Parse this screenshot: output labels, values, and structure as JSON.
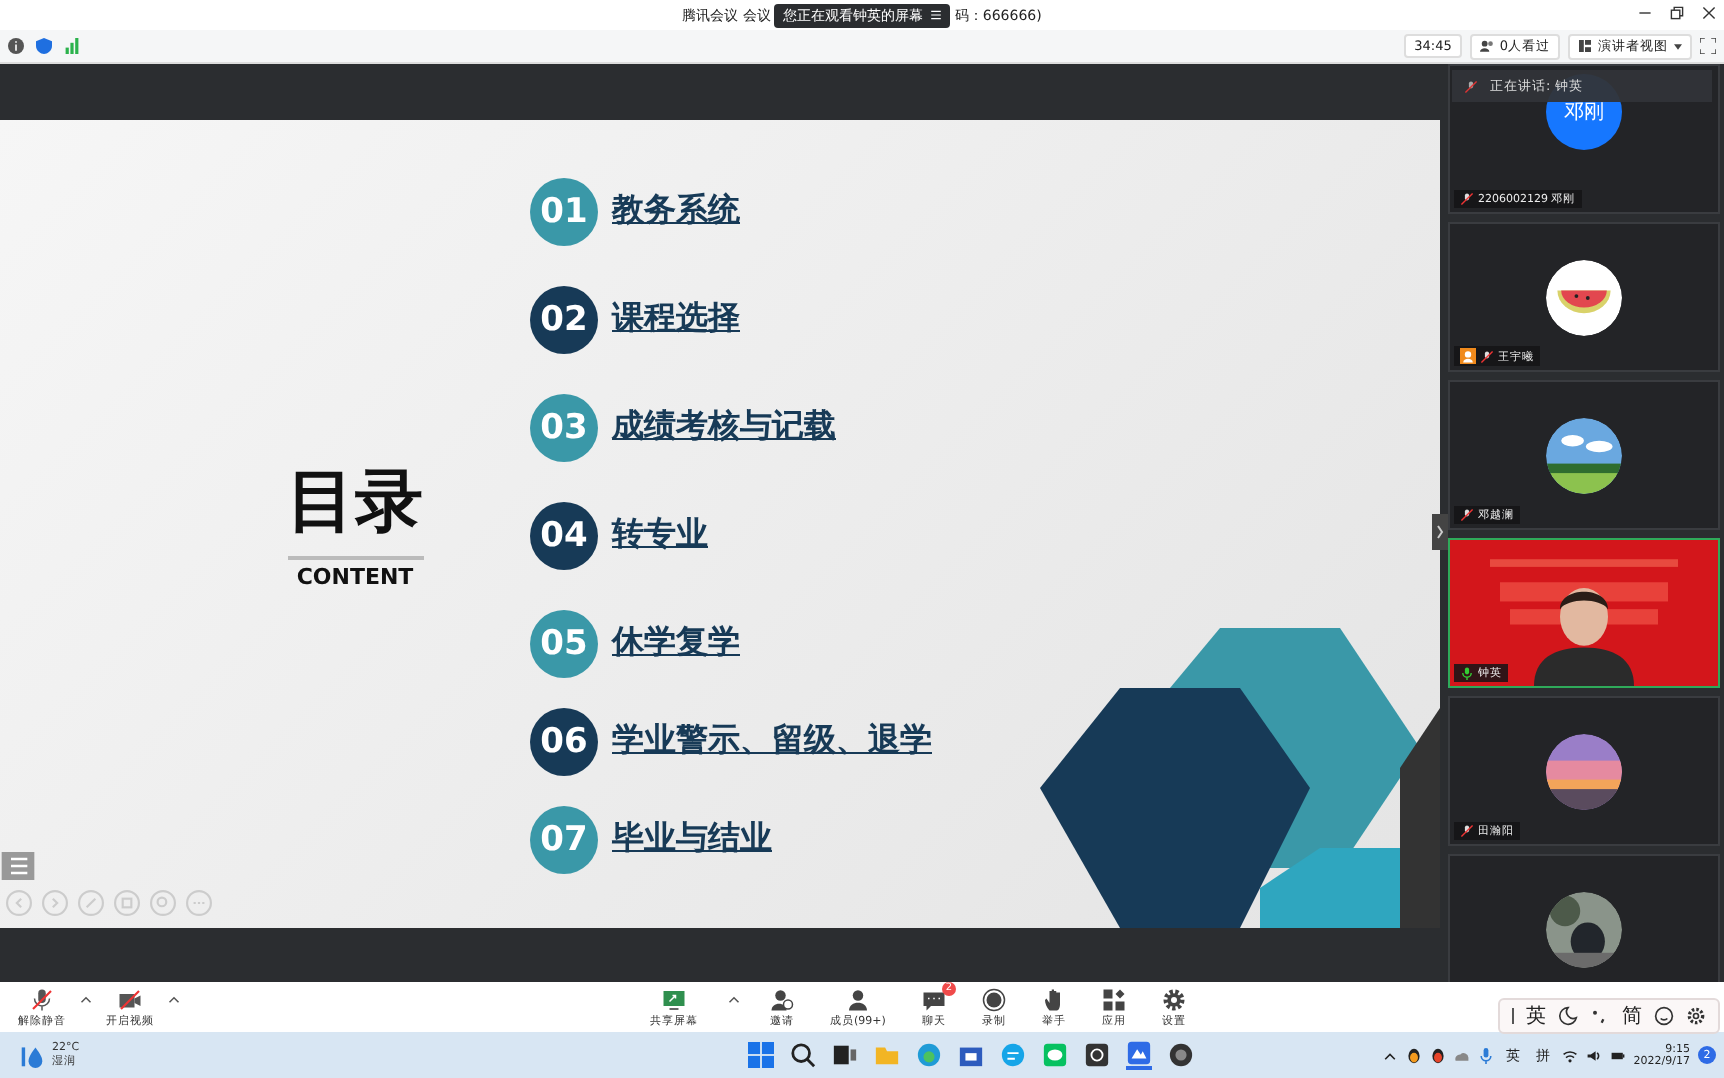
{
  "window": {
    "title_start": "腾讯会议 会议",
    "title_end": "码：666666)",
    "tooltip": "您正在观看钟英的屏幕"
  },
  "toolbar": {
    "timer": "34:45",
    "viewers": "0人看过",
    "view_mode": "演讲者视图"
  },
  "slide": {
    "title": "目录",
    "subtitle": "CONTENT",
    "items": [
      {
        "number": "01",
        "label": "教务系统",
        "color": "#3a98a8"
      },
      {
        "number": "02",
        "label": "课程选择",
        "color": "#173a57"
      },
      {
        "number": "03",
        "label": "成绩考核与记载",
        "color": "#3a98a8"
      },
      {
        "number": "04",
        "label": "转专业",
        "color": "#173a57"
      },
      {
        "number": "05",
        "label": "休学复学",
        "color": "#3a98a8"
      },
      {
        "number": "06",
        "label": "学业警示、留级、退学",
        "color": "#173a57"
      },
      {
        "number": "07",
        "label": "毕业与结业",
        "color": "#3a98a8"
      }
    ]
  },
  "participants": {
    "speaking": "正在讲话: 钟英",
    "tiles": [
      {
        "kind": "initials",
        "avatar": "邓刚",
        "name": "2206002129 邓刚",
        "host": false,
        "muted": true
      },
      {
        "kind": "picture",
        "name": "王宇曦",
        "host": true,
        "muted": true
      },
      {
        "kind": "picture",
        "name": "邓越澜",
        "host": false,
        "muted": true
      },
      {
        "kind": "video",
        "name": "钟英",
        "host": false,
        "muted": false
      },
      {
        "kind": "picture",
        "name": "田瀚阳",
        "host": false,
        "muted": true
      },
      {
        "kind": "picture"
      }
    ]
  },
  "controls": [
    {
      "kind": "mic",
      "label": "解除静音",
      "menu": true
    },
    {
      "kind": "camera",
      "label": "开启视频",
      "menu": true
    },
    {
      "kind": "share",
      "label": "共享屏幕",
      "menu": true
    },
    {
      "kind": "invite",
      "label": "邀请",
      "menu": false
    },
    {
      "kind": "members",
      "label": "成员(99+)",
      "menu": false
    },
    {
      "kind": "chat",
      "label": "聊天",
      "menu": false,
      "badge": "2"
    },
    {
      "kind": "record",
      "label": "录制",
      "menu": false
    },
    {
      "kind": "hand",
      "label": "举手",
      "menu": false
    },
    {
      "kind": "apps",
      "label": "应用",
      "menu": false
    },
    {
      "kind": "settings",
      "label": "设置",
      "menu": false
    }
  ],
  "ime": {
    "language": "英",
    "script": "简"
  },
  "taskbar": {
    "temperature": "22°C",
    "weather": "湿润",
    "language": "英",
    "input": "拼",
    "time": "9:15",
    "date": "2022/9/17",
    "notifications": "2"
  }
}
